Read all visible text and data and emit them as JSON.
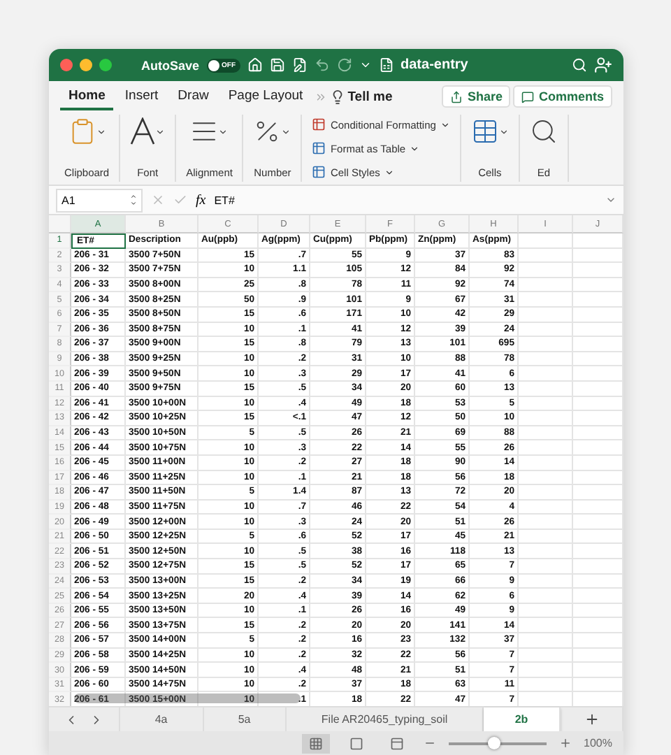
{
  "title_bar": {
    "autosave_label": "AutoSave",
    "autosave_state": "OFF",
    "autosave_on": false,
    "doc_title": "data-entry"
  },
  "ribbon_tabs": [
    {
      "label": "Home",
      "selected": true
    },
    {
      "label": "Insert",
      "selected": false
    },
    {
      "label": "Draw",
      "selected": false
    },
    {
      "label": "Page Layout",
      "selected": false
    }
  ],
  "tell_me": "Tell me",
  "share": "Share",
  "comments": "Comments",
  "ribbon_groups": [
    {
      "kind": "clipboard",
      "label": "Clipboard"
    },
    {
      "kind": "font",
      "label": "Font"
    },
    {
      "kind": "alignment",
      "label": "Alignment"
    },
    {
      "kind": "number",
      "label": "Number"
    },
    {
      "kind": "styles",
      "items": [
        "Conditional Formatting",
        "Format as Table",
        "Cell Styles"
      ]
    },
    {
      "kind": "cells",
      "label": "Cells"
    },
    {
      "kind": "editing",
      "label": "Ed"
    }
  ],
  "formula_bar": {
    "name_box": "A1",
    "fx": "fx",
    "value": "ET#"
  },
  "columns": [
    {
      "label": "A",
      "selected": true
    },
    {
      "label": "B",
      "selected": false
    },
    {
      "label": "C",
      "selected": false
    },
    {
      "label": "D",
      "selected": false
    },
    {
      "label": "E",
      "selected": false
    },
    {
      "label": "F",
      "selected": false
    },
    {
      "label": "G",
      "selected": false
    },
    {
      "label": "H",
      "selected": false
    },
    {
      "label": "I",
      "selected": false
    },
    {
      "label": "J",
      "selected": false
    }
  ],
  "rows": [
    {
      "number": "1",
      "cells": [
        "ET#",
        "Description",
        "Au(ppb)",
        "Ag(ppm)",
        "Cu(ppm)",
        "Pb(ppm)",
        "Zn(ppm)",
        "As(ppm)"
      ]
    },
    {
      "number": "2",
      "cells": [
        "206 - 31",
        "3500 7+50N",
        "15",
        ".7",
        "55",
        "9",
        "37",
        "83"
      ]
    },
    {
      "number": "3",
      "cells": [
        "206 - 32",
        "3500 7+75N",
        "10",
        "1.1",
        "105",
        "12",
        "84",
        "92"
      ]
    },
    {
      "number": "4",
      "cells": [
        "206 - 33",
        "3500 8+00N",
        "25",
        ".8",
        "78",
        "11",
        "92",
        "74"
      ]
    },
    {
      "number": "5",
      "cells": [
        "206 - 34",
        "3500 8+25N",
        "50",
        ".9",
        "101",
        "9",
        "67",
        "31"
      ]
    },
    {
      "number": "6",
      "cells": [
        "206 - 35",
        "3500 8+50N",
        "15",
        ".6",
        "171",
        "10",
        "42",
        "29"
      ]
    },
    {
      "number": "7",
      "cells": [
        "206 - 36",
        "3500 8+75N",
        "10",
        ".1",
        "41",
        "12",
        "39",
        "24"
      ]
    },
    {
      "number": "8",
      "cells": [
        "206 - 37",
        "3500 9+00N",
        "15",
        ".8",
        "79",
        "13",
        "101",
        "695"
      ]
    },
    {
      "number": "9",
      "cells": [
        "206 - 38",
        "3500 9+25N",
        "10",
        ".2",
        "31",
        "10",
        "88",
        "78"
      ]
    },
    {
      "number": "10",
      "cells": [
        "206 - 39",
        "3500 9+50N",
        "10",
        ".3",
        "29",
        "17",
        "41",
        "6"
      ]
    },
    {
      "number": "11",
      "cells": [
        "206 - 40",
        "3500 9+75N",
        "15",
        ".5",
        "34",
        "20",
        "60",
        "13"
      ]
    },
    {
      "number": "12",
      "cells": [
        "206 - 41",
        "3500 10+00N",
        "10",
        ".4",
        "49",
        "18",
        "53",
        "5"
      ]
    },
    {
      "number": "13",
      "cells": [
        "206 - 42",
        "3500 10+25N",
        "15",
        "<.1",
        "47",
        "12",
        "50",
        "10"
      ]
    },
    {
      "number": "14",
      "cells": [
        "206 - 43",
        "3500 10+50N",
        "5",
        ".5",
        "26",
        "21",
        "69",
        "88"
      ]
    },
    {
      "number": "15",
      "cells": [
        "206 - 44",
        "3500 10+75N",
        "10",
        ".3",
        "22",
        "14",
        "55",
        "26"
      ]
    },
    {
      "number": "16",
      "cells": [
        "206 - 45",
        "3500 11+00N",
        "10",
        ".2",
        "27",
        "18",
        "90",
        "14"
      ]
    },
    {
      "number": "17",
      "cells": [
        "206 - 46",
        "3500 11+25N",
        "10",
        ".1",
        "21",
        "18",
        "56",
        "18"
      ]
    },
    {
      "number": "18",
      "cells": [
        "206 - 47",
        "3500 11+50N",
        "5",
        "1.4",
        "87",
        "13",
        "72",
        "20"
      ]
    },
    {
      "number": "19",
      "cells": [
        "206 - 48",
        "3500 11+75N",
        "10",
        ".7",
        "46",
        "22",
        "54",
        "4"
      ]
    },
    {
      "number": "20",
      "cells": [
        "206 - 49",
        "3500 12+00N",
        "10",
        ".3",
        "24",
        "20",
        "51",
        "26"
      ]
    },
    {
      "number": "21",
      "cells": [
        "206 - 50",
        "3500 12+25N",
        "5",
        ".6",
        "52",
        "17",
        "45",
        "21"
      ]
    },
    {
      "number": "22",
      "cells": [
        "206 - 51",
        "3500 12+50N",
        "10",
        ".5",
        "38",
        "16",
        "118",
        "13"
      ]
    },
    {
      "number": "23",
      "cells": [
        "206 - 52",
        "3500 12+75N",
        "15",
        ".5",
        "52",
        "17",
        "65",
        "7"
      ]
    },
    {
      "number": "24",
      "cells": [
        "206 - 53",
        "3500 13+00N",
        "15",
        ".2",
        "34",
        "19",
        "66",
        "9"
      ]
    },
    {
      "number": "25",
      "cells": [
        "206 - 54",
        "3500 13+25N",
        "20",
        ".4",
        "39",
        "14",
        "62",
        "6"
      ]
    },
    {
      "number": "26",
      "cells": [
        "206 - 55",
        "3500 13+50N",
        "10",
        ".1",
        "26",
        "16",
        "49",
        "9"
      ]
    },
    {
      "number": "27",
      "cells": [
        "206 - 56",
        "3500 13+75N",
        "15",
        ".2",
        "20",
        "20",
        "141",
        "14"
      ]
    },
    {
      "number": "28",
      "cells": [
        "206 - 57",
        "3500 14+00N",
        "5",
        ".2",
        "16",
        "23",
        "132",
        "37"
      ]
    },
    {
      "number": "29",
      "cells": [
        "206 - 58",
        "3500 14+25N",
        "10",
        ".2",
        "32",
        "22",
        "56",
        "7"
      ]
    },
    {
      "number": "30",
      "cells": [
        "206 - 59",
        "3500 14+50N",
        "10",
        ".4",
        "48",
        "21",
        "51",
        "7"
      ]
    },
    {
      "number": "31",
      "cells": [
        "206 - 60",
        "3500 14+75N",
        "10",
        ".2",
        "37",
        "18",
        "63",
        "11"
      ]
    },
    {
      "number": "32",
      "cells": [
        "206 - 61",
        "3500 15+00N",
        "10",
        ".1",
        "18",
        "22",
        "47",
        "7"
      ]
    }
  ],
  "sheet_tabs": [
    {
      "label": "4a",
      "selected": false
    },
    {
      "label": "5a",
      "selected": false
    },
    {
      "label": "File AR20465_typing_soil",
      "selected": false
    },
    {
      "label": "2b",
      "selected": true
    }
  ],
  "zoom": {
    "level": 0.47,
    "reading": "100%"
  }
}
